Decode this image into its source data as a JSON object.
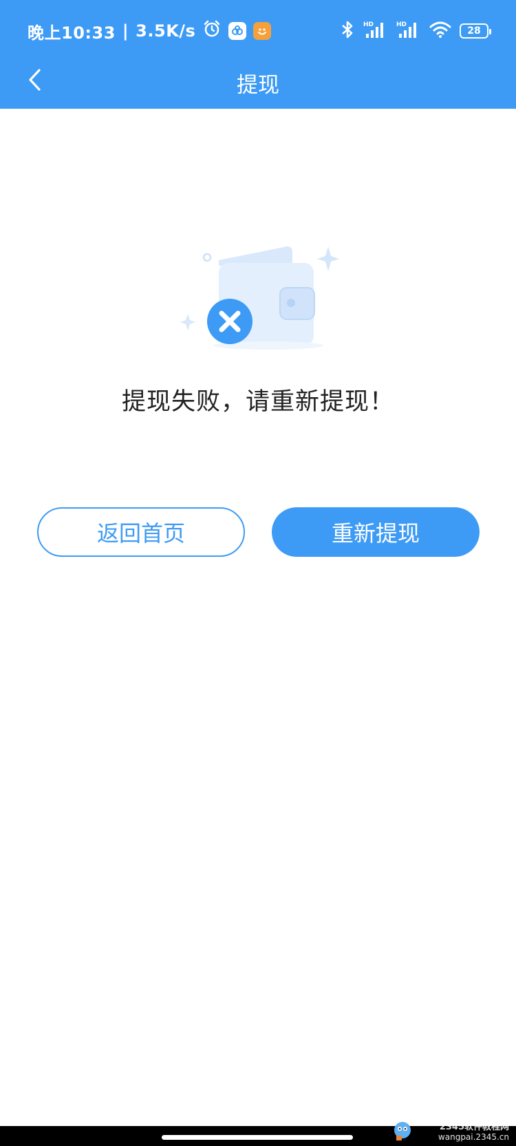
{
  "status_bar": {
    "time": "晚上10:33",
    "separator": "|",
    "net_speed": "3.5K/s",
    "battery": "28",
    "icons": [
      "alarm-icon",
      "app-badge-icon",
      "app-badge-orange-icon",
      "bluetooth-icon",
      "signal-hd-icon",
      "signal-hd-icon",
      "wifi-icon",
      "battery-icon"
    ]
  },
  "nav": {
    "back_icon": "chevron-left-icon",
    "title": "提现"
  },
  "result": {
    "illustration_icon": "wallet-failed-icon",
    "message": "提现失败，请重新提现！"
  },
  "buttons": {
    "home": "返回首页",
    "retry": "重新提现"
  },
  "watermark": {
    "line1": "2345软件教程网",
    "line2": "wangpai.2345.cn"
  },
  "colors": {
    "primary": "#3d9bf5",
    "text": "#222222",
    "background": "#ffffff"
  }
}
